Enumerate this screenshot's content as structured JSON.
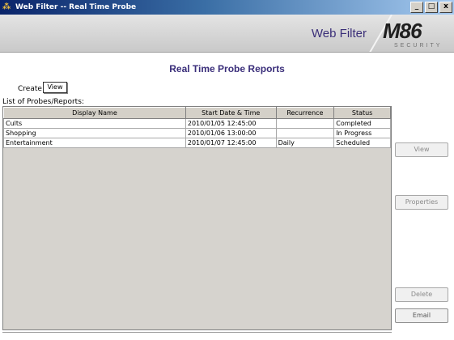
{
  "window": {
    "title": "Web Filter -- Real Time Probe",
    "controls": {
      "minimize": "_",
      "maximize": "□",
      "close": "x"
    }
  },
  "banner": {
    "product": "Web Filter",
    "logo_text": "M86",
    "logo_sub": "SECURITY"
  },
  "page": {
    "heading": "Real Time Probe Reports",
    "create_label": "Create",
    "create_button": "View",
    "list_label": "List of Probes/Reports:"
  },
  "table": {
    "columns": [
      "Display Name",
      "Start Date & Time",
      "Recurrence",
      "Status"
    ],
    "rows": [
      [
        "Cults",
        "2010/01/05 12:45:00",
        "",
        "Completed"
      ],
      [
        "Shopping",
        "2010/01/06 13:00:00",
        "",
        "In Progress"
      ],
      [
        "Entertainment",
        "2010/01/07 12:45:00",
        "Daily",
        "Scheduled"
      ]
    ]
  },
  "actions": {
    "view": "View",
    "properties": "Properties",
    "delete": "Delete",
    "email": "Email"
  }
}
